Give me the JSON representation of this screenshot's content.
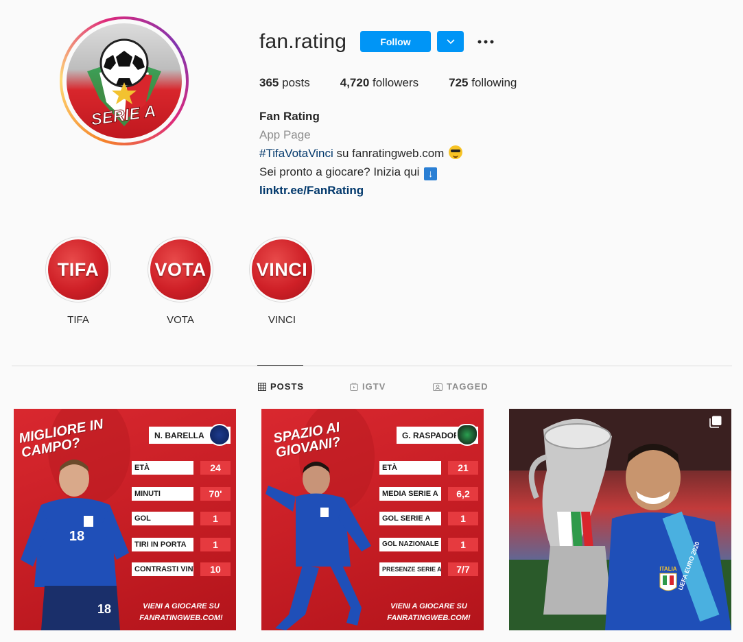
{
  "profile": {
    "username": "fan.rating",
    "follow_label": "Follow",
    "avatar_text": "SERIE A",
    "stats": [
      {
        "count": "365",
        "label": "posts"
      },
      {
        "count": "4,720",
        "label": "followers"
      },
      {
        "count": "725",
        "label": "following"
      }
    ],
    "bio": {
      "name": "Fan Rating",
      "category": "App Page",
      "hashtag": "#TifaVotaVinci",
      "line1_rest": " su fanratingweb.com ",
      "line2": "Sei pronto a giocare? Inizia qui ",
      "link": "linktr.ee/FanRating"
    }
  },
  "highlights": [
    {
      "cover_text": "TIFA",
      "label": "TIFA"
    },
    {
      "cover_text": "VOTA",
      "label": "VOTA"
    },
    {
      "cover_text": "VINCI",
      "label": "VINCI"
    }
  ],
  "tabs": [
    {
      "label": "POSTS",
      "icon": "grid-icon",
      "active": true
    },
    {
      "label": "IGTV",
      "icon": "igtv-icon",
      "active": false
    },
    {
      "label": "TAGGED",
      "icon": "tagged-icon",
      "active": false
    }
  ],
  "posts": [
    {
      "title": "MIGLIORE IN\nCAMPO?",
      "player": "N. BARELLA",
      "rows": [
        {
          "label": "ETÀ",
          "value": "24"
        },
        {
          "label": "MINUTI",
          "value": "70'"
        },
        {
          "label": "GOL",
          "value": "1"
        },
        {
          "label": "TIRI IN PORTA",
          "value": "1"
        },
        {
          "label": "CONTRASTI VINTI",
          "value": "10"
        }
      ],
      "cta": "VIENI A GIOCARE SU\nFANRATINGWEB.COM!",
      "jersey_number": "18"
    },
    {
      "title": "SPAZIO AI\nGIOVANI?",
      "player": "G. RASPADORI",
      "rows": [
        {
          "label": "ETÀ",
          "value": "21"
        },
        {
          "label": "MEDIA SERIE A",
          "value": "6,2"
        },
        {
          "label": "GOL SERIE A",
          "value": "1"
        },
        {
          "label": "GOL NAZIONALE",
          "value": "1"
        },
        {
          "label": "PRESENZE SERIE A",
          "value": "7/7"
        }
      ],
      "cta": "VIENI A GIOCARE SU\nFANRATINGWEB.COM!"
    },
    {
      "type": "photo",
      "banner_text": "UEFA EURO 2020",
      "jersey_text": "ITALIA"
    }
  ]
}
